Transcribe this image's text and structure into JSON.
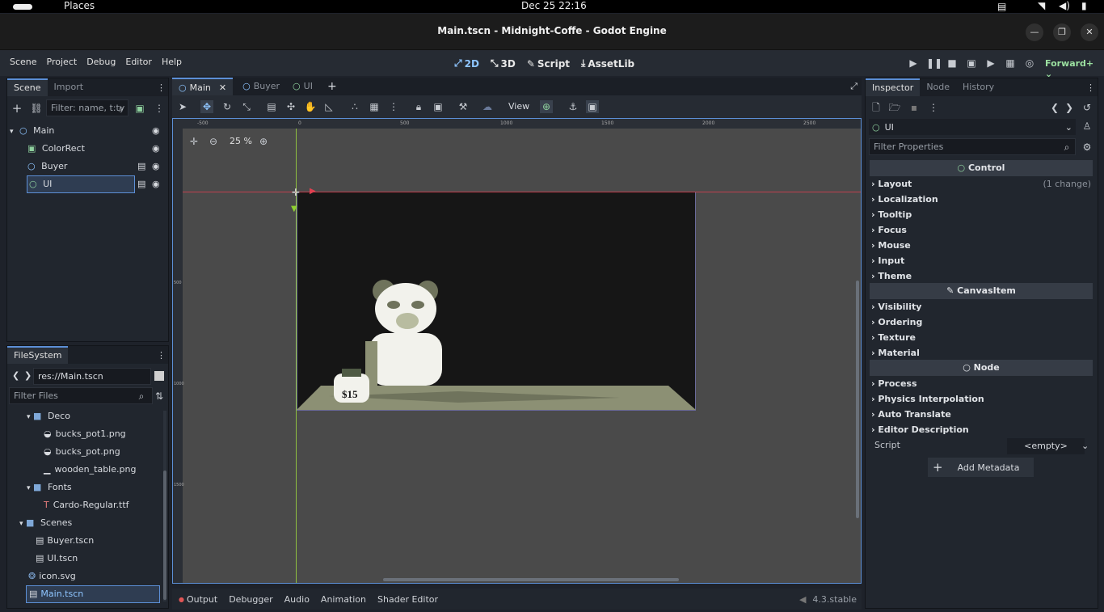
{
  "system_bar": {
    "places": "Places",
    "datetime": "Dec 25  22:16"
  },
  "window": {
    "title": "Main.tscn - Midnight-Coffe - Godot Engine"
  },
  "menu": [
    "Scene",
    "Project",
    "Debug",
    "Editor",
    "Help"
  ],
  "modes": {
    "m2d": "2D",
    "m3d": "3D",
    "script": "Script",
    "assetlib": "AssetLib"
  },
  "renderer": "Forward+",
  "scene_dock": {
    "tabs": [
      "Scene",
      "Import"
    ],
    "filter_placeholder": "Filter: name, t:ty",
    "nodes": [
      "Main",
      "ColorRect",
      "Buyer",
      "UI"
    ]
  },
  "filesystem": {
    "tab": "FileSystem",
    "path": "res://Main.tscn",
    "filter_placeholder": "Filter Files",
    "items": [
      "Deco",
      "bucks_pot1.png",
      "bucks_pot.png",
      "wooden_table.png",
      "Fonts",
      "Cardo-Regular.ttf",
      "Scenes",
      "Buyer.tscn",
      "UI.tscn",
      "icon.svg",
      "Main.tscn"
    ]
  },
  "editor_tabs": [
    "Main",
    "Buyer",
    "UI"
  ],
  "toolbar": {
    "view": "View"
  },
  "viewport": {
    "zoom": "25 %",
    "ruler_labels": [
      "-500",
      "0",
      "500",
      "1000",
      "1500",
      "2000",
      "2500"
    ],
    "vruler_labels": [
      "500",
      "1000",
      "1500"
    ],
    "price_text": "$15"
  },
  "bottom_panel": {
    "tabs": [
      "Output",
      "Debugger",
      "Audio",
      "Animation",
      "Shader Editor"
    ],
    "version": "4.3.stable"
  },
  "inspector": {
    "tabs": [
      "Inspector",
      "Node",
      "History"
    ],
    "selected": "UI",
    "filter_placeholder": "Filter Properties",
    "control_header": "Control",
    "control_props": [
      "Layout",
      "Localization",
      "Tooltip",
      "Focus",
      "Mouse",
      "Input",
      "Theme"
    ],
    "layout_change": "(1 change)",
    "canvas_header": "CanvasItem",
    "canvas_props": [
      "Visibility",
      "Ordering",
      "Texture",
      "Material"
    ],
    "node_header": "Node",
    "node_props": [
      "Process",
      "Physics Interpolation",
      "Auto Translate",
      "Editor Description"
    ],
    "script_label": "Script",
    "script_value": "<empty>",
    "add_metadata": "Add Metadata"
  },
  "colors": {
    "accent": "#5c8fd6",
    "canvas_bg": "#4a4a4a",
    "scene_bg": "#161616",
    "art_green": "#8c9074"
  }
}
